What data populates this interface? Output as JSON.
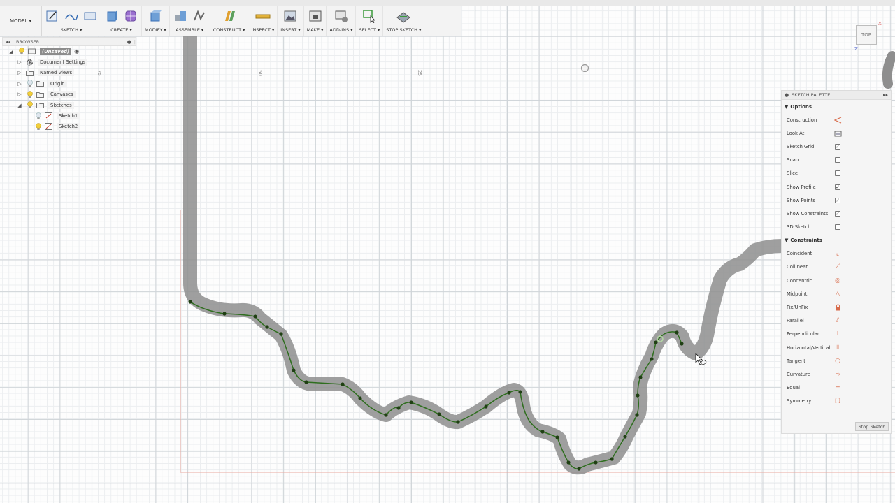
{
  "toolbar": {
    "workspace": "MODEL",
    "groups": [
      {
        "label": "SKETCH",
        "icons": [
          "sketch-create-icon",
          "spline-icon",
          "rectangle-icon"
        ]
      },
      {
        "label": "CREATE",
        "icons": [
          "extrude-icon",
          "form-icon"
        ]
      },
      {
        "label": "MODIFY",
        "icons": [
          "press-pull-icon"
        ]
      },
      {
        "label": "ASSEMBLE",
        "icons": [
          "new-component-icon",
          "joint-icon"
        ]
      },
      {
        "label": "CONSTRUCT",
        "icons": [
          "offset-plane-icon"
        ]
      },
      {
        "label": "INSPECT",
        "icons": [
          "measure-icon"
        ]
      },
      {
        "label": "INSERT",
        "icons": [
          "insert-image-icon"
        ]
      },
      {
        "label": "MAKE",
        "icons": [
          "make-3d-print-icon"
        ]
      },
      {
        "label": "ADD-INS",
        "icons": [
          "addins-icon"
        ]
      },
      {
        "label": "SELECT",
        "icons": [
          "select-icon"
        ]
      },
      {
        "label": "STOP SKETCH",
        "icons": [
          "stop-sketch-icon"
        ]
      }
    ]
  },
  "browser": {
    "title": "BROWSER",
    "items": [
      {
        "label": "(Unsaved)",
        "level": 0,
        "expanded": true
      },
      {
        "label": "Document Settings",
        "level": 1,
        "expanded": false
      },
      {
        "label": "Named Views",
        "level": 1,
        "expanded": false
      },
      {
        "label": "Origin",
        "level": 1,
        "expanded": false
      },
      {
        "label": "Canvases",
        "level": 1,
        "expanded": false
      },
      {
        "label": "Sketches",
        "level": 1,
        "expanded": true
      },
      {
        "label": "Sketch1",
        "level": 2
      },
      {
        "label": "Sketch2",
        "level": 2
      }
    ]
  },
  "viewcube": {
    "face": "TOP",
    "x_axis": "X",
    "z_axis": "Z"
  },
  "rulers": [
    "75",
    "50",
    "25"
  ],
  "palette": {
    "title": "SKETCH PALETTE",
    "options_title": "Options",
    "options": [
      {
        "label": "Construction",
        "control": "icon",
        "icon": "construction-icon"
      },
      {
        "label": "Look At",
        "control": "icon",
        "icon": "look-at-icon"
      },
      {
        "label": "Sketch Grid",
        "control": "checkbox",
        "checked": true
      },
      {
        "label": "Snap",
        "control": "checkbox",
        "checked": false
      },
      {
        "label": "Slice",
        "control": "checkbox",
        "checked": false
      },
      {
        "label": "Show Profile",
        "control": "checkbox",
        "checked": true
      },
      {
        "label": "Show Points",
        "control": "checkbox",
        "checked": true
      },
      {
        "label": "Show Constraints",
        "control": "checkbox",
        "checked": true
      },
      {
        "label": "3D Sketch",
        "control": "checkbox",
        "checked": false
      }
    ],
    "constraints_title": "Constraints",
    "constraints": [
      {
        "label": "Coincident",
        "icon": "coincident-icon",
        "glyph": "⌞"
      },
      {
        "label": "Collinear",
        "icon": "collinear-icon",
        "glyph": "⟋"
      },
      {
        "label": "Concentric",
        "icon": "concentric-icon",
        "glyph": "◎"
      },
      {
        "label": "Midpoint",
        "icon": "midpoint-icon",
        "glyph": "△"
      },
      {
        "label": "Fix/UnFix",
        "icon": "lock-icon",
        "glyph": "🔒"
      },
      {
        "label": "Parallel",
        "icon": "parallel-icon",
        "glyph": "⫽"
      },
      {
        "label": "Perpendicular",
        "icon": "perpendicular-icon",
        "glyph": "⟂"
      },
      {
        "label": "Horizontal/Vertical",
        "icon": "horizontal-vertical-icon",
        "glyph": "⫫"
      },
      {
        "label": "Tangent",
        "icon": "tangent-icon",
        "glyph": "○"
      },
      {
        "label": "Curvature",
        "icon": "curvature-icon",
        "glyph": "⤳"
      },
      {
        "label": "Equal",
        "icon": "equal-icon",
        "glyph": "="
      },
      {
        "label": "Symmetry",
        "icon": "symmetry-icon",
        "glyph": "[ ]"
      }
    ],
    "stop_label": "Stop Sketch"
  },
  "colors": {
    "accent_orange": "#d86b4b",
    "spline_green": "#2e6e1e",
    "offset_gray": "#8a8a8a"
  }
}
